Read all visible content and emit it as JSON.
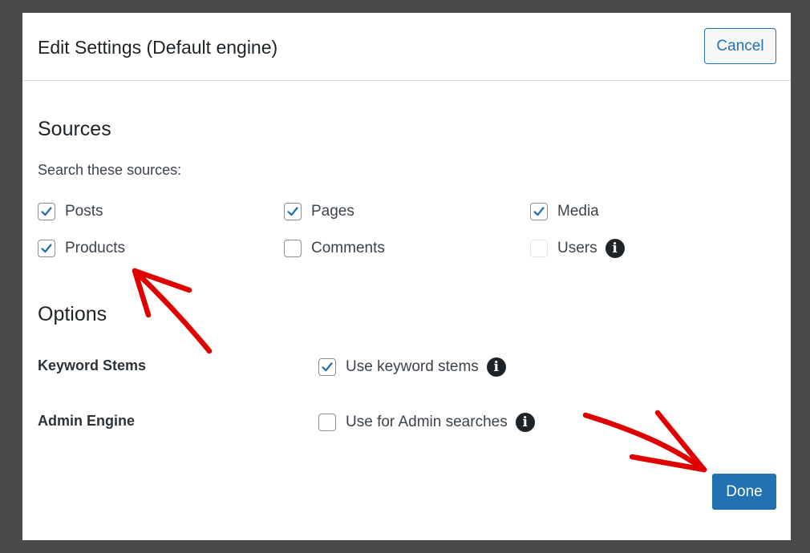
{
  "modal": {
    "title": "Edit Settings (Default engine)",
    "cancel_label": "Cancel",
    "done_label": "Done"
  },
  "sources": {
    "heading": "Sources",
    "subtitle": "Search these sources:",
    "items": [
      {
        "label": "Posts",
        "checked": true,
        "disabled": false
      },
      {
        "label": "Pages",
        "checked": true,
        "disabled": false
      },
      {
        "label": "Media",
        "checked": true,
        "disabled": false
      },
      {
        "label": "Products",
        "checked": true,
        "disabled": false
      },
      {
        "label": "Comments",
        "checked": false,
        "disabled": false
      },
      {
        "label": "Users",
        "checked": false,
        "disabled": true,
        "info_icon": "info-icon"
      }
    ]
  },
  "options": {
    "heading": "Options",
    "rows": [
      {
        "label": "Keyword Stems",
        "checkbox_label": "Use keyword stems",
        "checked": true,
        "info_icon": "info-icon"
      },
      {
        "label": "Admin Engine",
        "checkbox_label": "Use for Admin searches",
        "checked": false,
        "info_icon": "info-icon"
      }
    ]
  },
  "colors": {
    "accent": "#2271b1",
    "checkmark": "#2271b1",
    "overlay": "#4a4a4d",
    "annotation": "#e00000"
  }
}
